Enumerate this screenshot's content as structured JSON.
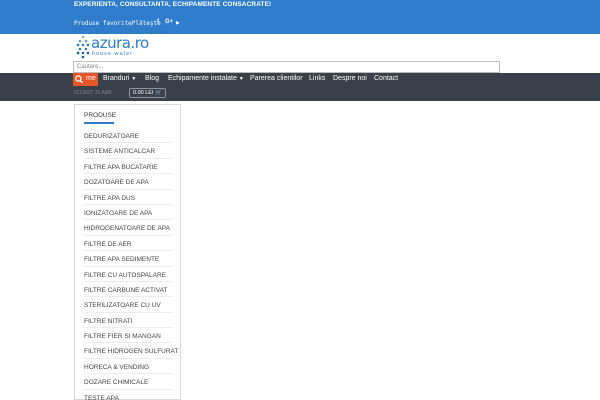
{
  "topbar": {
    "slogan": "EXPERIENTA, CONSULTANTA, ECHIPAMENTE CONSACRATE!",
    "links": "Produse favoritePlăteşte",
    "social": [
      {
        "icon": "facebook-icon",
        "label": "f"
      },
      {
        "icon": "google-plus-icon",
        "label": "G+"
      },
      {
        "icon": "youtube-icon",
        "label": "▶"
      }
    ]
  },
  "logo": {
    "name": "azura.ro",
    "tagline": "house water"
  },
  "search": {
    "placeholder": "Cautare..."
  },
  "nav": {
    "home": "me",
    "items": [
      "Branduri",
      "Blog",
      "Echipamente instalate",
      "Parerea clientilor",
      "Links",
      "Despre noi",
      "Contact"
    ]
  },
  "header": {
    "phone": "0213037 31 ABB",
    "cart": "0.00 LEI"
  },
  "sidebar": {
    "title": "PRODUSE",
    "categories": [
      "DEDURIZATOARE",
      "SISTEME ANTICALCAR",
      "FILTRE APA BUCATARIE",
      "DOZATOARE DE APA",
      "FILTRE APA DUS",
      "IONIZATOARE DE APA",
      "HIDROGENATOARE DE APA",
      "FILTRE DE AER",
      "FILTRE APA SEDIMENTE",
      "FILTRE CU AUTOSPALARE",
      "FILTRE CARBUNE ACTIVAT",
      "STERILIZATOARE CU UV",
      "FILTRE NITRATI",
      "FILTRE FIER SI MANGAN",
      "FILTRE HIDROGEN SULFURAT",
      "HORECA & VENDING",
      "DOZARE CHIMICALE",
      "TESTE APA"
    ]
  },
  "colors": {
    "brand": "#2f7ccb",
    "nav": "#39404a",
    "accent": "#e5572a"
  }
}
